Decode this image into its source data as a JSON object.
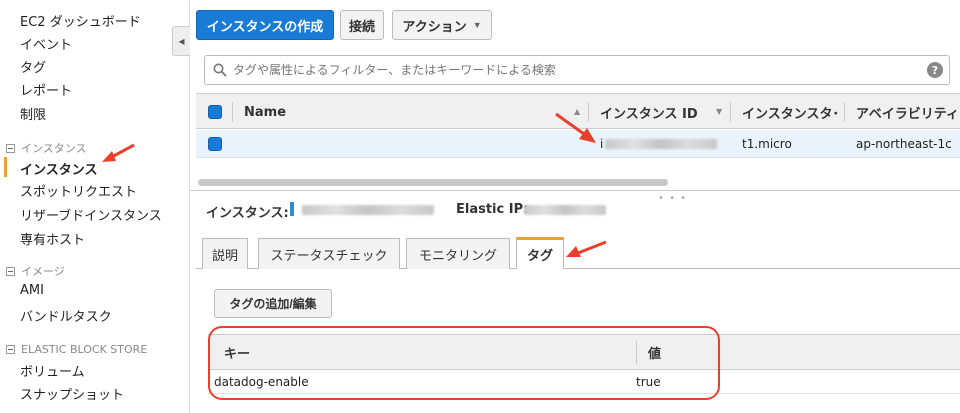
{
  "sidebar": {
    "dashboard": "EC2 ダッシュボード",
    "events": "イベント",
    "tags": "タグ",
    "reports": "レポート",
    "limits": "制限",
    "section_instances": "インスタンス",
    "instances": "インスタンス",
    "spot_requests": "スポットリクエスト",
    "reserved_instances": "リザーブドインスタンス",
    "dedicated_hosts": "専有ホスト",
    "section_images": "イメージ",
    "ami": "AMI",
    "bundle_tasks": "バンドルタスク",
    "section_ebs": "ELASTIC BLOCK STORE",
    "volumes": "ボリューム",
    "snapshots": "スナップショット"
  },
  "toolbar": {
    "launch_label": "インスタンスの作成",
    "connect_label": "接続",
    "actions_label": "アクション"
  },
  "search": {
    "placeholder": "タグや属性によるフィルター、またはキーワードによる検索",
    "help": "?"
  },
  "table": {
    "columns": [
      "Name",
      "インスタンス ID",
      "インスタンスタ･",
      "アベイラビリティー"
    ],
    "rows": [
      {
        "name": "",
        "instance_id_prefix": "i",
        "instance_type": "t1.micro",
        "az": "ap-northeast-1c"
      }
    ]
  },
  "details": {
    "instance_label": "インスタンス:",
    "eip_label": "Elastic IP:",
    "tabs": [
      "説明",
      "ステータスチェック",
      "モニタリング",
      "タグ"
    ],
    "active_tab": "タグ",
    "edit_tags_label": "タグの追加/編集",
    "tag_table": {
      "key_header": "キー",
      "value_header": "値",
      "rows": [
        {
          "key": "datadog-enable",
          "value": "true"
        }
      ]
    }
  },
  "colors": {
    "primary": "#1a7bd6",
    "accent": "#f0a030",
    "annotation": "#e8402c"
  }
}
